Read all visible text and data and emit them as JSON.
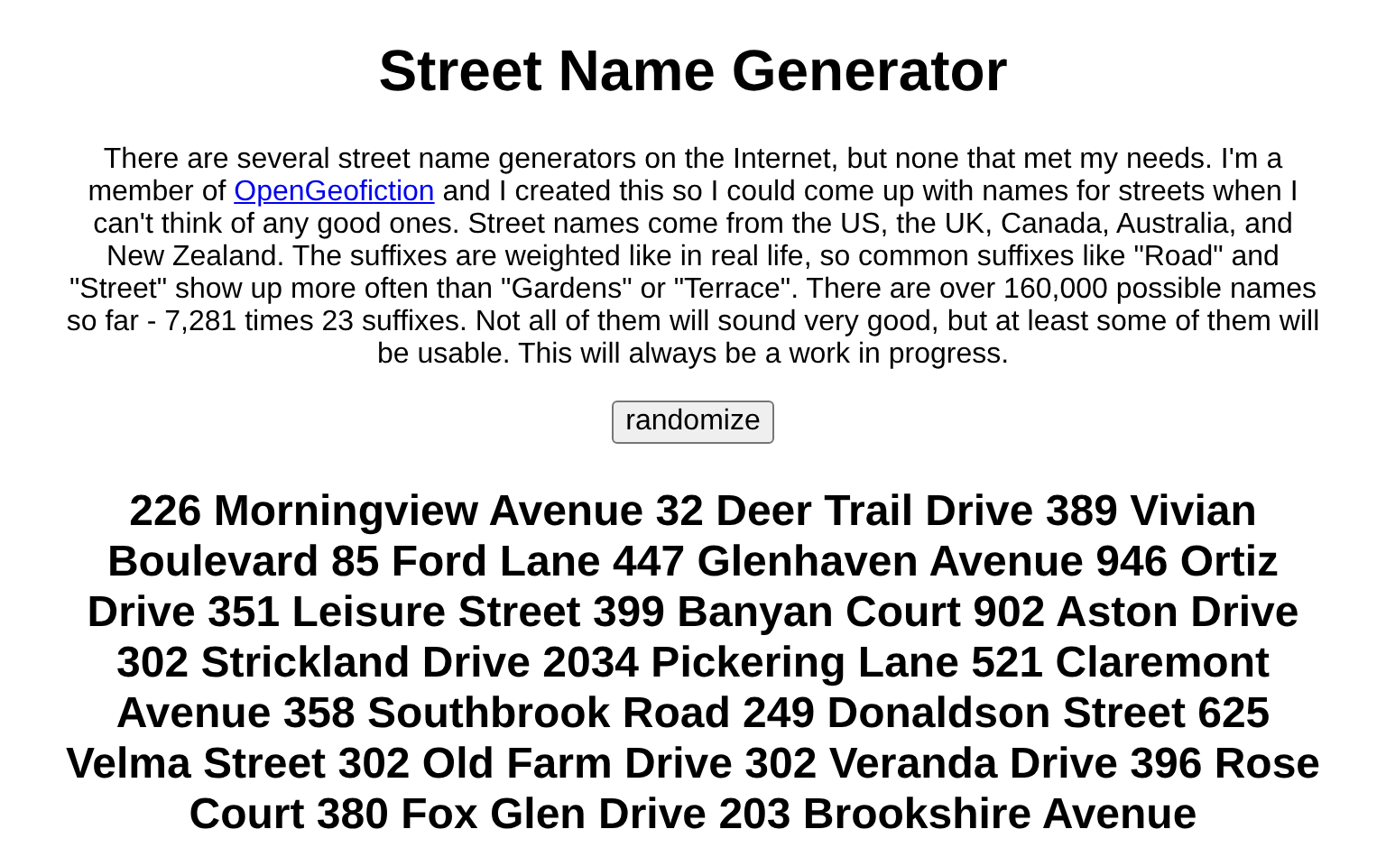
{
  "title": "Street Name Generator",
  "intro": {
    "before": "There are several street name generators on the Internet, but none that met my needs. I'm a member of",
    "link": "OpenGeofiction",
    "after": "and I created this so I could come up with names for streets when I can't think of any good ones. Street names come from the US, the UK, Canada, Australia, and New Zealand. The suffixes are weighted like in real life, so common suffixes like \"Road\" and \"Street\" show up more often than \"Gardens\" or \"Terrace\". There are over 160,000 possible names so far - 7,281 times 23 suffixes. Not all of them will sound very good, but at least some of them will be usable. This will always be a work in progress."
  },
  "button": "randomize",
  "names": [
    "226 Morningview Avenue",
    "32 Deer Trail Drive",
    "389 Vivian Boulevard",
    "85 Ford Lane",
    "447 Glenhaven Avenue",
    "946 Ortiz Drive",
    "351 Leisure Street",
    "399 Banyan Court",
    "902 Aston Drive",
    "302 Strickland Drive",
    "2034 Pickering Lane",
    "521 Claremont Avenue",
    "358 Southbrook Road",
    "249 Donaldson Street",
    "625 Velma Street",
    "302 Old Farm Drive",
    "302 Veranda Drive",
    "396 Rose Court",
    "380 Fox Glen Drive",
    "203 Brookshire Avenue"
  ]
}
